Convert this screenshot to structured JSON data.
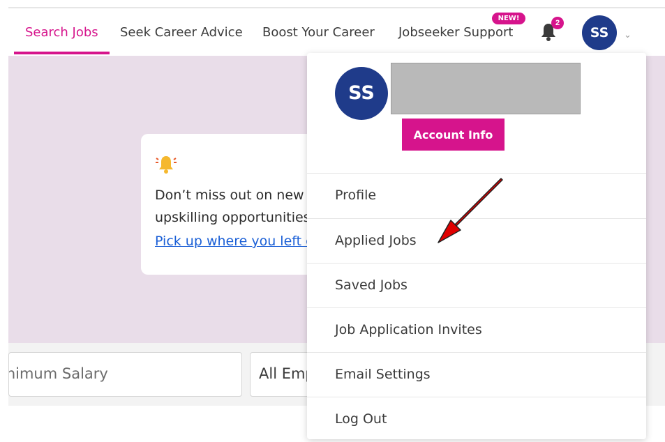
{
  "nav": {
    "links": [
      "Search Jobs",
      "Seek Career Advice",
      "Boost Your Career",
      "Jobseeker Support"
    ],
    "new_badge": "NEW!",
    "notification_count": "2",
    "avatar_initials": "SS"
  },
  "notice": {
    "line1": "Don’t miss out on new c",
    "line2": "upskilling opportunities",
    "link": "Pick up where you left c"
  },
  "search": {
    "salary_placeholder": "inimum Salary",
    "employment_select": "All Emp"
  },
  "dropdown": {
    "avatar_initials": "SS",
    "account_button": "Account Info",
    "items": [
      "Profile",
      "Applied Jobs",
      "Saved Jobs",
      "Job Application Invites",
      "Email Settings",
      "Log Out"
    ]
  },
  "colors": {
    "accent": "#d6148c",
    "avatar": "#1f3b8a",
    "hero_bg": "#e9dde9",
    "arrow": "#e00000"
  }
}
